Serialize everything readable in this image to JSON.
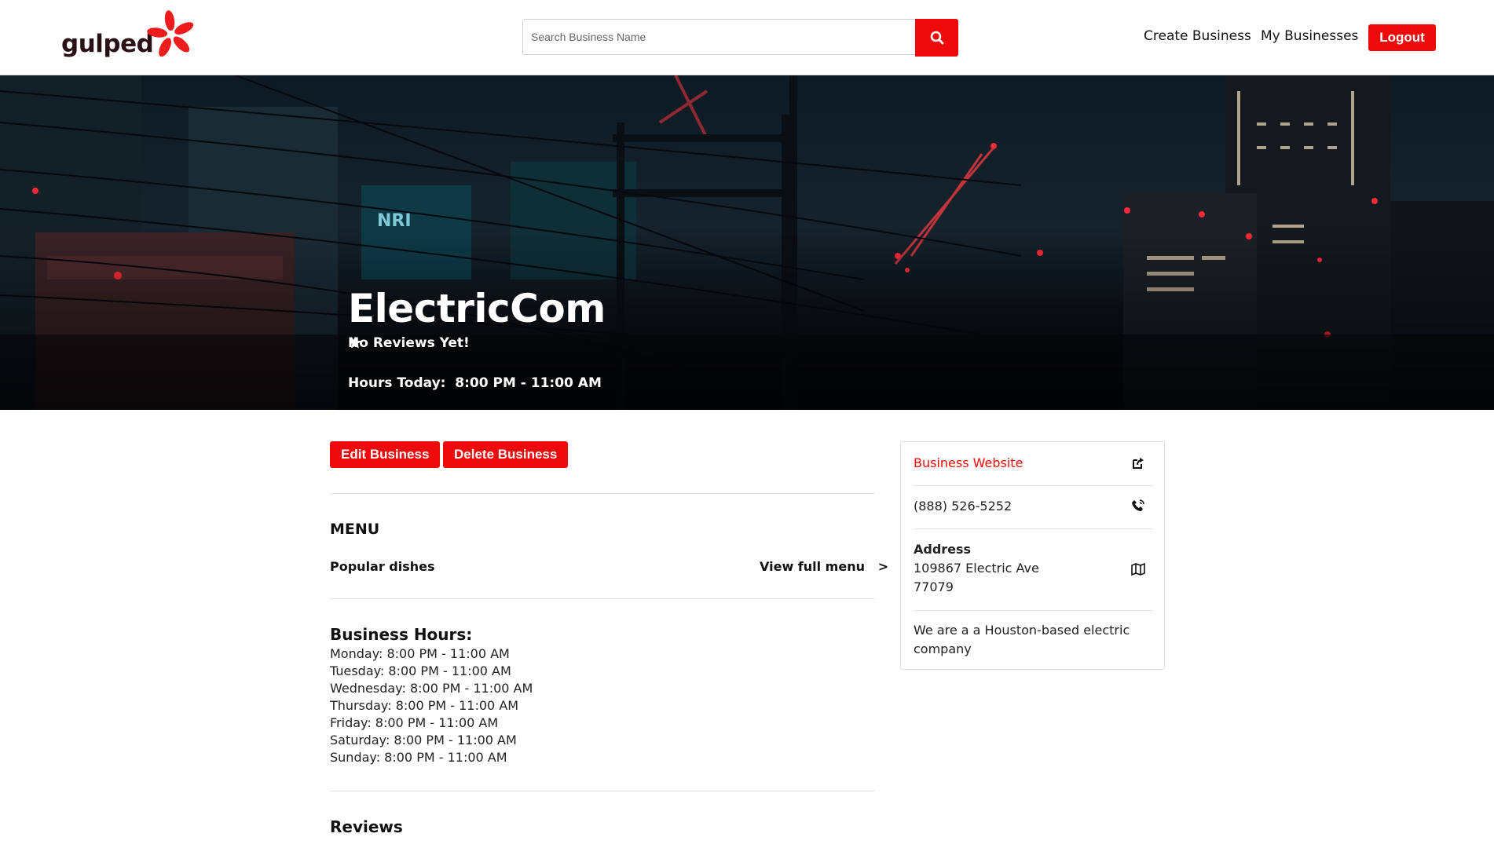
{
  "header": {
    "logo_text": "gulped",
    "search_placeholder": "Search Business Name",
    "nav": {
      "create": "Create Business",
      "mine": "My Businesses",
      "logout": "Logout"
    }
  },
  "hero": {
    "name": "ElectricCom",
    "reviews_text": "No Reviews Yet!",
    "hours_label": "Hours Today:",
    "hours_value": "8:00 PM - 11:00 AM"
  },
  "actions": {
    "edit": "Edit Business",
    "delete": "Delete Business"
  },
  "menu": {
    "title": "MENU",
    "popular": "Popular dishes",
    "view_full": "View full menu",
    "view_arrow": ">"
  },
  "hours": {
    "title": "Business Hours:",
    "days": [
      "Monday: 8:00 PM - 11:00 AM",
      "Tuesday: 8:00 PM - 11:00 AM",
      "Wednesday: 8:00 PM - 11:00 AM",
      "Thursday: 8:00 PM - 11:00 AM",
      "Friday: 8:00 PM - 11:00 AM",
      "Saturday: 8:00 PM - 11:00 AM",
      "Sunday: 8:00 PM - 11:00 AM"
    ]
  },
  "reviews": {
    "title": "Reviews"
  },
  "info": {
    "website": "Business Website",
    "phone": "(888) 526-5252",
    "address_label": "Address",
    "address_line1": "109867 Electric Ave",
    "address_line2": "77079",
    "description": "We are a a Houston-based electric company"
  },
  "colors": {
    "brand_red": "#ee0a0a",
    "logo_dark": "#2a0f14"
  },
  "icons": [
    "search-icon",
    "star-icon",
    "external-link-icon",
    "phone-icon",
    "map-icon",
    "logo-burst-icon"
  ]
}
